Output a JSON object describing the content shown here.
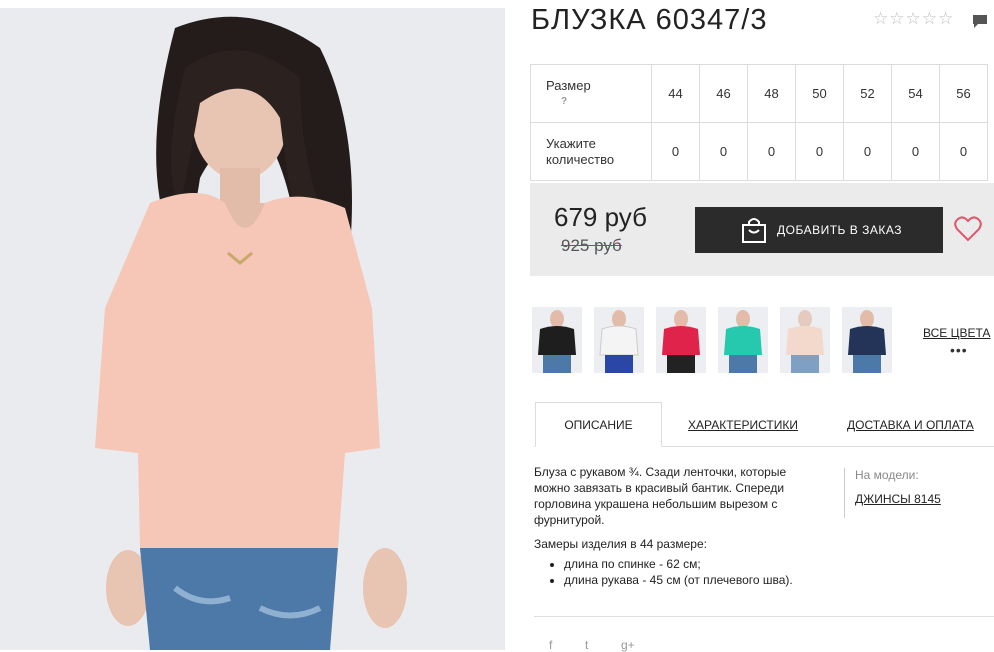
{
  "product": {
    "title": "БЛУЗКА 60347/3",
    "rating_stars": 5
  },
  "sizes": {
    "size_label": "Размер",
    "help": "?",
    "qty_label_line1": "Укажите",
    "qty_label_line2": "количество",
    "values": [
      "44",
      "46",
      "48",
      "50",
      "52",
      "54",
      "56"
    ],
    "quantities": [
      "0",
      "0",
      "0",
      "0",
      "0",
      "0",
      "0"
    ]
  },
  "price": {
    "current": "679 руб",
    "old": "925 руб",
    "add_button": "ДОБАВИТЬ В ЗАКАЗ"
  },
  "colors": {
    "thumbs": [
      "black",
      "white",
      "red",
      "turquoise",
      "peach",
      "navy"
    ],
    "thumb_hex": [
      "#1e1e1e",
      "#f4f4f4",
      "#e0234b",
      "#26c9ad",
      "#f3d8cc",
      "#243458"
    ],
    "all_colors": "ВСЕ ЦВЕТА",
    "more": "•••"
  },
  "tabs": {
    "description": "ОПИСАНИЕ",
    "specs": "ХАРАКТЕРИСТИКИ",
    "delivery": "ДОСТАВКА И ОПЛАТА"
  },
  "description": {
    "text": "Блуза с рукавом ¾. Сзади ленточки, которые можно завязать в красивый бантик. Спереди горловина украшена небольшим вырезом с фурнитурой.",
    "measure_title": "Замеры изделия в 44 размере:",
    "items": [
      "длина по спинке - 62 см;",
      "длина рукава - 45 см (от плечевого шва)."
    ]
  },
  "model": {
    "label": "На модели:",
    "item": "ДЖИНСЫ 8145"
  },
  "social": {
    "facebook": "f",
    "twitter": "t",
    "google": "g+"
  },
  "colors_theme": {
    "accent_heart": "#e0566b",
    "button_bg": "#2b2b2b",
    "price_strike": "#d9302f"
  }
}
